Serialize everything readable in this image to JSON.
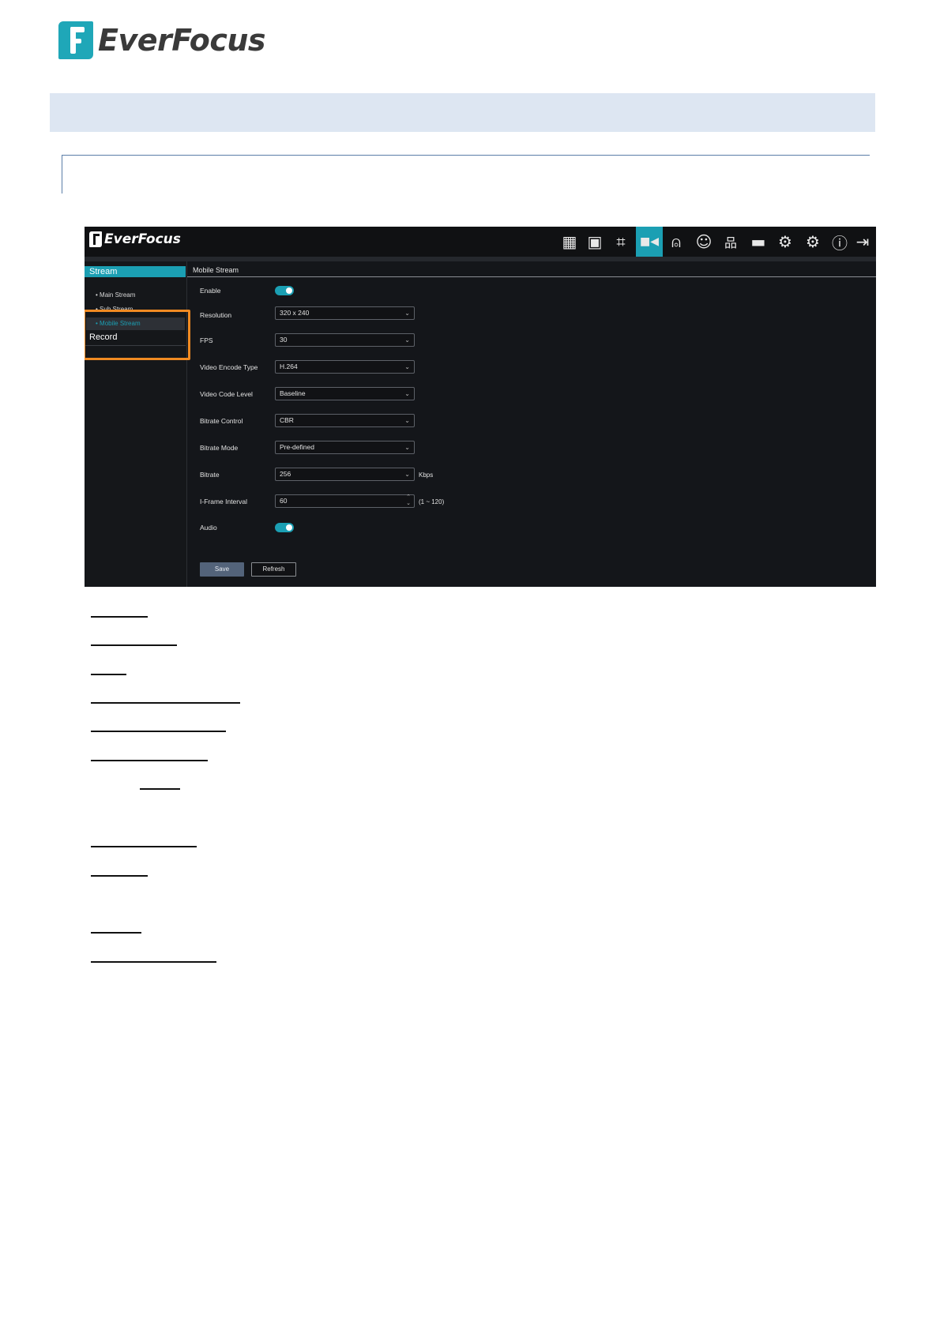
{
  "doc_header": {
    "brand": "EverFocus"
  },
  "ui": {
    "brand": "EverFocus",
    "toolbar": [
      {
        "name": "live-view-icon",
        "glyph": "▦"
      },
      {
        "name": "playback-icon",
        "glyph": "▣"
      },
      {
        "name": "snapshot-icon",
        "glyph": "⌗"
      },
      {
        "name": "camera-icon",
        "glyph": "■◀"
      },
      {
        "name": "alarm-icon",
        "glyph": "⍝"
      },
      {
        "name": "ai-icon",
        "glyph": "☺"
      },
      {
        "name": "network-icon",
        "glyph": "品"
      },
      {
        "name": "storage-icon",
        "glyph": "▬"
      },
      {
        "name": "settings-icon",
        "glyph": "⚙"
      },
      {
        "name": "advanced-settings-icon",
        "glyph": "⚙"
      },
      {
        "name": "info-icon",
        "glyph": "ⓘ"
      },
      {
        "name": "logout-icon",
        "glyph": "⇥"
      }
    ],
    "active_icon": "camera-icon",
    "accent": "#1b9fb3",
    "sidebar": {
      "stream": "Stream",
      "items": [
        "Main Stream",
        "Sub Stream",
        "Mobile Stream"
      ],
      "record": "Record"
    },
    "main": {
      "title": "Mobile Stream",
      "fields": {
        "enable": "Enable",
        "resolution": "Resolution",
        "resolution_value": "320 x 240",
        "fps": "FPS",
        "fps_value": "30",
        "video_encode_type": "Video Encode Type",
        "video_encode_type_value": "H.264",
        "video_code_level": "Video Code Level",
        "video_code_level_value": "Baseline",
        "bitrate_control": "Bitrate Control",
        "bitrate_control_value": "CBR",
        "bitrate_mode": "Bitrate Mode",
        "bitrate_mode_value": "Pre-defined",
        "bitrate": "Bitrate",
        "bitrate_value": "256",
        "bitrate_unit": "Kbps",
        "iframe_interval": "I-Frame Interval",
        "iframe_interval_value": "60",
        "iframe_interval_range": "(1 ~ 120)",
        "audio": "Audio"
      },
      "save": "Save",
      "refresh": "Refresh"
    }
  }
}
